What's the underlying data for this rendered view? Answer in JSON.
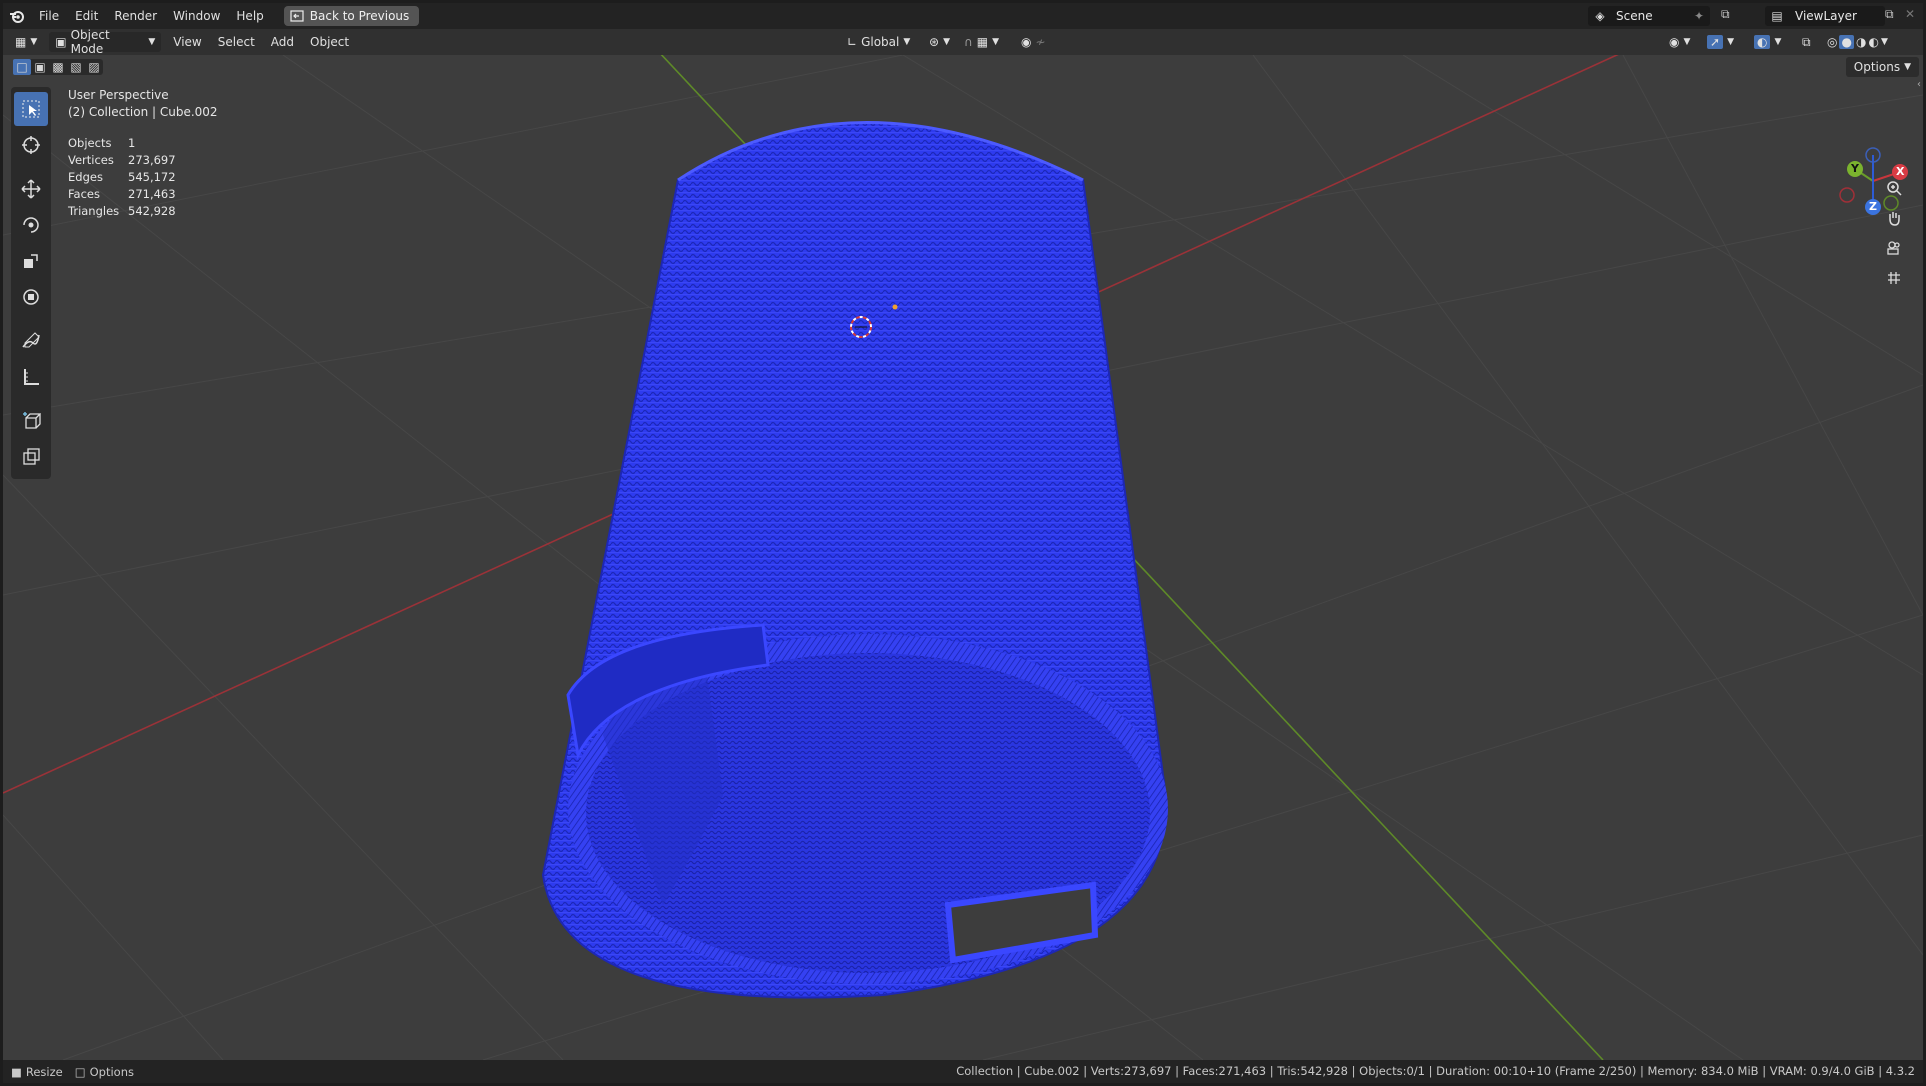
{
  "topbar": {
    "menus": [
      "File",
      "Edit",
      "Render",
      "Window",
      "Help"
    ],
    "back_button": "Back to Previous",
    "scene": "Scene",
    "view_layer": "ViewLayer"
  },
  "header": {
    "mode": "Object Mode",
    "menus": [
      "View",
      "Select",
      "Add",
      "Object"
    ],
    "transform_orientation": "Global"
  },
  "viewport": {
    "options_label": "Options",
    "view_name": "User Perspective",
    "collection_info": "(2) Collection | Cube.002",
    "stats": [
      {
        "label": "Objects",
        "value": "1"
      },
      {
        "label": "Vertices",
        "value": "273,697"
      },
      {
        "label": "Edges",
        "value": "545,172"
      },
      {
        "label": "Faces",
        "value": "271,463"
      },
      {
        "label": "Triangles",
        "value": "542,928"
      }
    ],
    "gizmo": {
      "x": "X",
      "y": "Y",
      "z": "Z"
    },
    "colors": {
      "background": "#3d3d3d",
      "mesh": "#2f3cf0",
      "x_axis": "#c8363c",
      "y_axis": "#6a9c2a",
      "active_tool": "#4772b3"
    }
  },
  "statusbar": {
    "left_items": [
      "Resize",
      "Options"
    ],
    "info": "Collection | Cube.002 | Verts:273,697 | Faces:271,463 | Tris:542,928 | Objects:0/1 | Duration: 00:10+10 (Frame 2/250) | Memory: 834.0 MiB | VRAM: 0.9/4.0 GiB | 4.3.2"
  }
}
